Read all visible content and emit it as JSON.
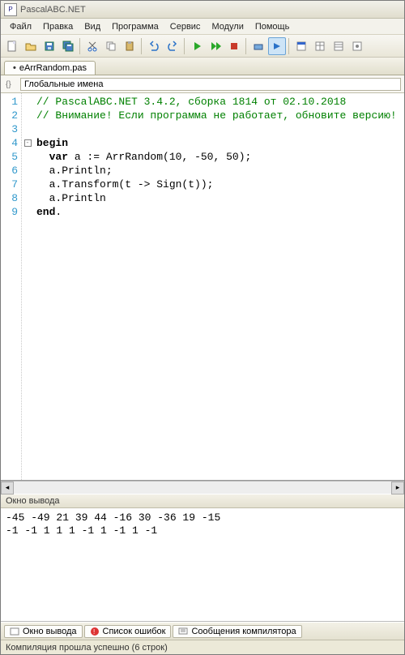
{
  "window": {
    "title": "PascalABC.NET"
  },
  "menu": {
    "file": "Файл",
    "edit": "Правка",
    "view": "Вид",
    "program": "Программа",
    "service": "Сервис",
    "modules": "Модули",
    "help": "Помощь"
  },
  "tab": {
    "name": "eArrRandom.pas",
    "modified": "•"
  },
  "intellisense": {
    "label": "Глобальные имена"
  },
  "code": {
    "lines": [
      {
        "n": "1",
        "cls": "c-comment",
        "text": "// PascalABC.NET 3.4.2, сборка 1814 от 02.10.2018"
      },
      {
        "n": "2",
        "cls": "c-comment",
        "text": "// Внимание! Если программа не работает, обновите версию!"
      },
      {
        "n": "3",
        "cls": "",
        "text": ""
      },
      {
        "n": "4",
        "cls": "",
        "text": "",
        "fold": "-"
      },
      {
        "n": "5",
        "cls": "",
        "text": ""
      },
      {
        "n": "6",
        "cls": "",
        "text": ""
      },
      {
        "n": "7",
        "cls": "",
        "text": ""
      },
      {
        "n": "8",
        "cls": "",
        "text": ""
      },
      {
        "n": "9",
        "cls": "",
        "text": ""
      }
    ],
    "l4_kw": "begin",
    "l5a": "  ",
    "l5_kw": "var",
    "l5b": " a := ArrRandom(",
    "l5c": "10",
    "l5d": ", ",
    "l5e": "-50",
    "l5f": ", ",
    "l5g": "50",
    "l5h": ");",
    "l6": "  a.Println;",
    "l7": "  a.Transform(t -> Sign(t));",
    "l8": "  a.Println",
    "l9_kw": "end",
    "l9b": "."
  },
  "output": {
    "title": "Окно вывода",
    "line1": "-45 -49 21 39 44 -16 30 -36 19 -15",
    "line2": "-1 -1 1 1 1 -1 1 -1 1 -1"
  },
  "bottomTabs": {
    "t1": "Окно вывода",
    "t2": "Список ошибок",
    "t3": "Сообщения компилятора"
  },
  "status": {
    "text": "Компиляция прошла успешно (6 строк)"
  }
}
